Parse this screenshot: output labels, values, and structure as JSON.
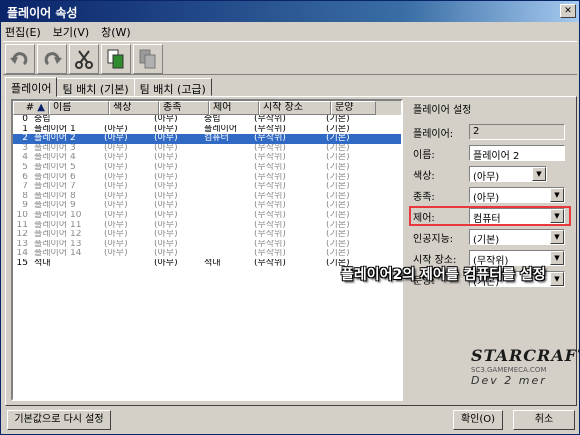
{
  "window": {
    "title": "플레이어 속성"
  },
  "menu": [
    "편집(E)",
    "보기(V)",
    "창(W)"
  ],
  "tabs": [
    "플레이어",
    "팀 배치 (기본)",
    "팀 배치 (고급)"
  ],
  "columns": [
    "#",
    "이름",
    "색상",
    "종족",
    "제어",
    "시작 장소",
    "문양"
  ],
  "rows": [
    {
      "n": "0",
      "name": "중립",
      "color": "",
      "race": "(아무)",
      "control": "중립",
      "start": "(무작위)",
      "sym": "(기본)",
      "state": "normal"
    },
    {
      "n": "1",
      "name": "플레이어 1",
      "color": "(아무)",
      "race": "(아무)",
      "control": "플레이어",
      "start": "(무작위)",
      "sym": "(기본)",
      "state": "normal"
    },
    {
      "n": "2",
      "name": "플레이어 2",
      "color": "(아무)",
      "race": "(아무)",
      "control": "컴퓨터",
      "start": "(무작위)",
      "sym": "(기본)",
      "state": "selected"
    },
    {
      "n": "3",
      "name": "플레이어 3",
      "color": "(아무)",
      "race": "(아무)",
      "control": "",
      "start": "(무작위)",
      "sym": "(기본)",
      "state": "dim"
    },
    {
      "n": "4",
      "name": "플레이어 4",
      "color": "(아무)",
      "race": "(아무)",
      "control": "",
      "start": "(무작위)",
      "sym": "(기본)",
      "state": "dim"
    },
    {
      "n": "5",
      "name": "플레이어 5",
      "color": "(아무)",
      "race": "(아무)",
      "control": "",
      "start": "(무작위)",
      "sym": "(기본)",
      "state": "dim"
    },
    {
      "n": "6",
      "name": "플레이어 6",
      "color": "(아무)",
      "race": "(아무)",
      "control": "",
      "start": "(무작위)",
      "sym": "(기본)",
      "state": "dim"
    },
    {
      "n": "7",
      "name": "플레이어 7",
      "color": "(아무)",
      "race": "(아무)",
      "control": "",
      "start": "(무작위)",
      "sym": "(기본)",
      "state": "dim"
    },
    {
      "n": "8",
      "name": "플레이어 8",
      "color": "(아무)",
      "race": "(아무)",
      "control": "",
      "start": "(무작위)",
      "sym": "(기본)",
      "state": "dim"
    },
    {
      "n": "9",
      "name": "플레이어 9",
      "color": "(아무)",
      "race": "(아무)",
      "control": "",
      "start": "(무작위)",
      "sym": "(기본)",
      "state": "dim"
    },
    {
      "n": "10",
      "name": "플레이어 10",
      "color": "(아무)",
      "race": "(아무)",
      "control": "",
      "start": "(무작위)",
      "sym": "(기본)",
      "state": "dim"
    },
    {
      "n": "11",
      "name": "플레이어 11",
      "color": "(아무)",
      "race": "(아무)",
      "control": "",
      "start": "(무작위)",
      "sym": "(기본)",
      "state": "dim"
    },
    {
      "n": "12",
      "name": "플레이어 12",
      "color": "(아무)",
      "race": "(아무)",
      "control": "",
      "start": "(무작위)",
      "sym": "(기본)",
      "state": "dim"
    },
    {
      "n": "13",
      "name": "플레이어 13",
      "color": "(아무)",
      "race": "(아무)",
      "control": "",
      "start": "(무작위)",
      "sym": "(기본)",
      "state": "dim"
    },
    {
      "n": "14",
      "name": "플레이어 14",
      "color": "(아무)",
      "race": "(아무)",
      "control": "",
      "start": "(무작위)",
      "sym": "(기본)",
      "state": "dim"
    },
    {
      "n": "15",
      "name": "적대",
      "color": "",
      "race": "(아무)",
      "control": "적대",
      "start": "(무작위)",
      "sym": "(기본)",
      "state": "normal"
    }
  ],
  "settings": {
    "title": "플레이어 설정",
    "player_label": "플레이어:",
    "player_value": "2",
    "name_label": "이름:",
    "name_value": "플레이어 2",
    "color_label": "색상:",
    "color_value": "(아무)",
    "race_label": "종족:",
    "race_value": "(아무)",
    "control_label": "제어:",
    "control_value": "컴퓨터",
    "ai_label": "인공지능:",
    "ai_value": "(기본)",
    "start_label": "시작 장소:",
    "start_value": "(무작위)",
    "sym_label": "문양:",
    "sym_value": "(기본)"
  },
  "annotation": "플레이어2의 제어를 컴퓨터를 설정",
  "logo": {
    "line1": "STARCRAFT",
    "line2": "SC3.GAMEMECA.COM",
    "line3": "Dev 2 mer"
  },
  "buttons": {
    "reset": "기본값으로 다시 설정",
    "ok": "확인(O)",
    "cancel": "취소"
  },
  "colors": {
    "highlight": "#e8383d",
    "selection": "#316ac5"
  }
}
